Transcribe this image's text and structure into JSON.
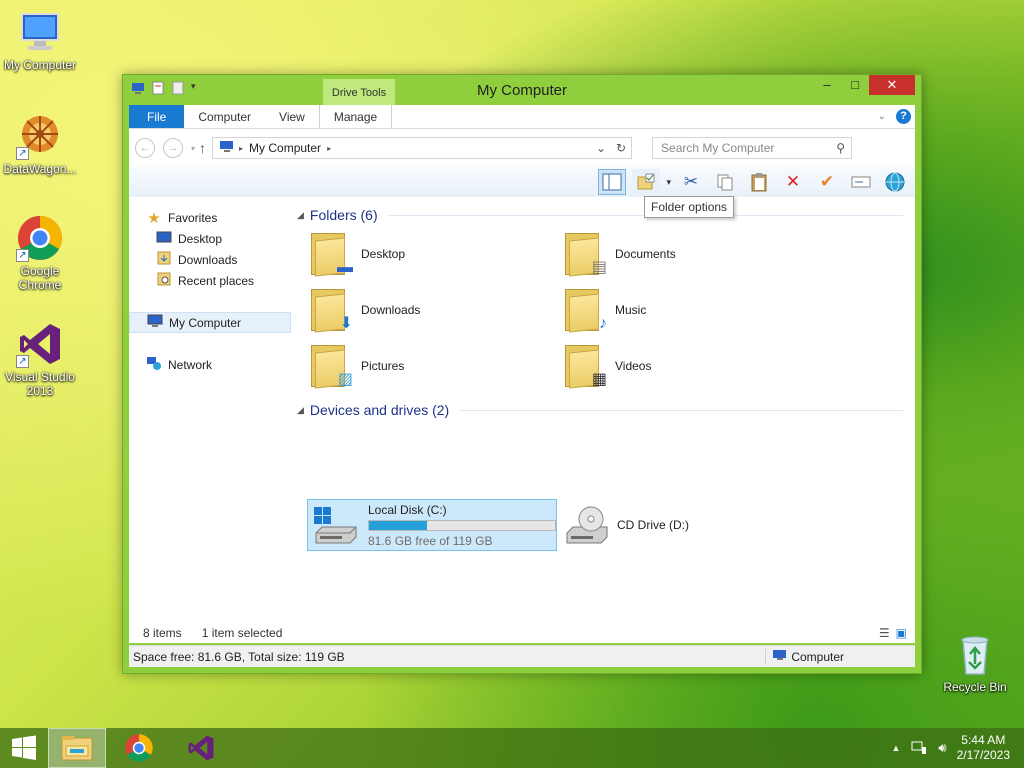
{
  "desktop": {
    "icons": [
      {
        "label": "My Computer",
        "icon": "computer-icon"
      },
      {
        "label": "DataWagon...",
        "icon": "datawagon-icon"
      },
      {
        "label": "Google Chrome",
        "icon": "chrome-icon"
      },
      {
        "label": "Visual Studio 2013",
        "icon": "visual-studio-icon"
      },
      {
        "label": "Recycle Bin",
        "icon": "recycle-bin-icon"
      }
    ]
  },
  "window": {
    "title": "My Computer",
    "contextual_tab_group": "Drive Tools",
    "controls": {
      "minimize": "–",
      "maximize": "□",
      "close": "✕"
    }
  },
  "ribbon": {
    "tabs": [
      "File",
      "Computer",
      "View",
      "Manage"
    ],
    "help": "?"
  },
  "navigation": {
    "address_path": "My Computer",
    "search_placeholder": "Search My Computer"
  },
  "toolbar": {
    "tooltip": "Folder options"
  },
  "sidebar": {
    "favorites": "Favorites",
    "favorites_items": [
      "Desktop",
      "Downloads",
      "Recent places"
    ],
    "computer": "My Computer",
    "network": "Network"
  },
  "groups": {
    "folders_header": "Folders (6)",
    "drives_header": "Devices and drives (2)"
  },
  "folders": [
    "Desktop",
    "Documents",
    "Downloads",
    "Music",
    "Pictures",
    "Videos"
  ],
  "drives": {
    "local": {
      "name": "Local Disk (C:)",
      "free_text": "81.6 GB free of 119 GB",
      "used_fraction": 0.314
    },
    "cd": {
      "name": "CD Drive (D:)"
    }
  },
  "status": {
    "item_count": "8 items",
    "selection": "1 item selected"
  },
  "details": {
    "space": "Space free: 81.6 GB, Total size: 119 GB",
    "location": "Computer"
  },
  "taskbar": {
    "time": "5:44 AM",
    "date": "2/17/2023"
  },
  "colors": {
    "accent": "#1a79d1",
    "window_frame": "#8fcf3e",
    "drive_bar": "#26a0da"
  }
}
